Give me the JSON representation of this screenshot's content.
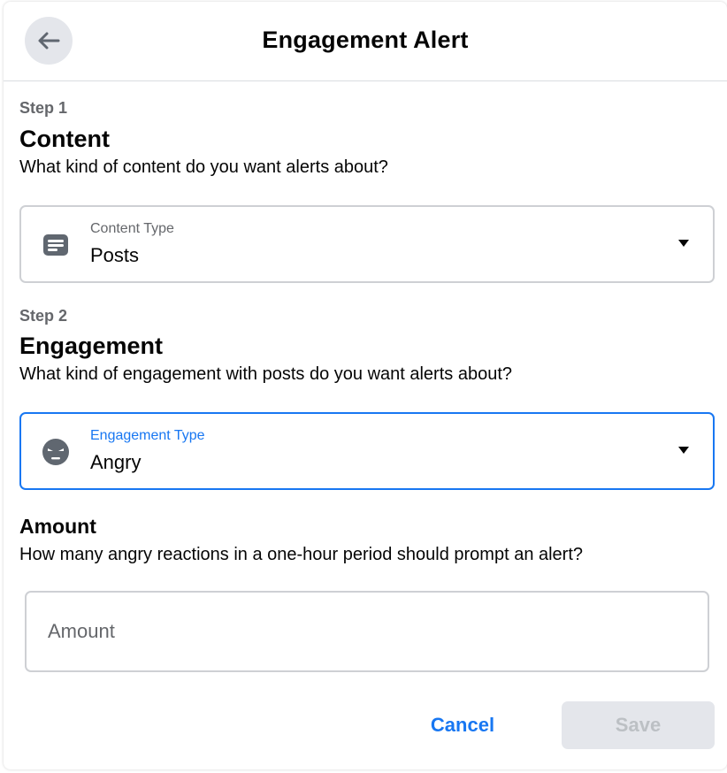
{
  "dialog": {
    "title": "Engagement Alert"
  },
  "step1": {
    "label": "Step 1",
    "title": "Content",
    "subtitle": "What kind of content do you want alerts about?",
    "select": {
      "label": "Content Type",
      "value": "Posts",
      "icon": "posts-icon"
    }
  },
  "step2": {
    "label": "Step 2",
    "title": "Engagement",
    "subtitle": "What kind of engagement with posts do you want alerts about?",
    "select": {
      "label": "Engagement Type",
      "value": "Angry",
      "icon": "angry-face-icon",
      "focused": true
    }
  },
  "amount": {
    "title": "Amount",
    "subtitle": "How many angry reactions in a one-hour period should prompt an alert?",
    "placeholder": "Amount",
    "value": ""
  },
  "footer": {
    "cancel_label": "Cancel",
    "save_label": "Save",
    "save_disabled": true
  },
  "colors": {
    "accent": "#1877f2",
    "secondary_text": "#65676b",
    "border": "#ced0d4",
    "disabled_bg": "#e4e6eb",
    "disabled_text": "#bcc0c4"
  }
}
